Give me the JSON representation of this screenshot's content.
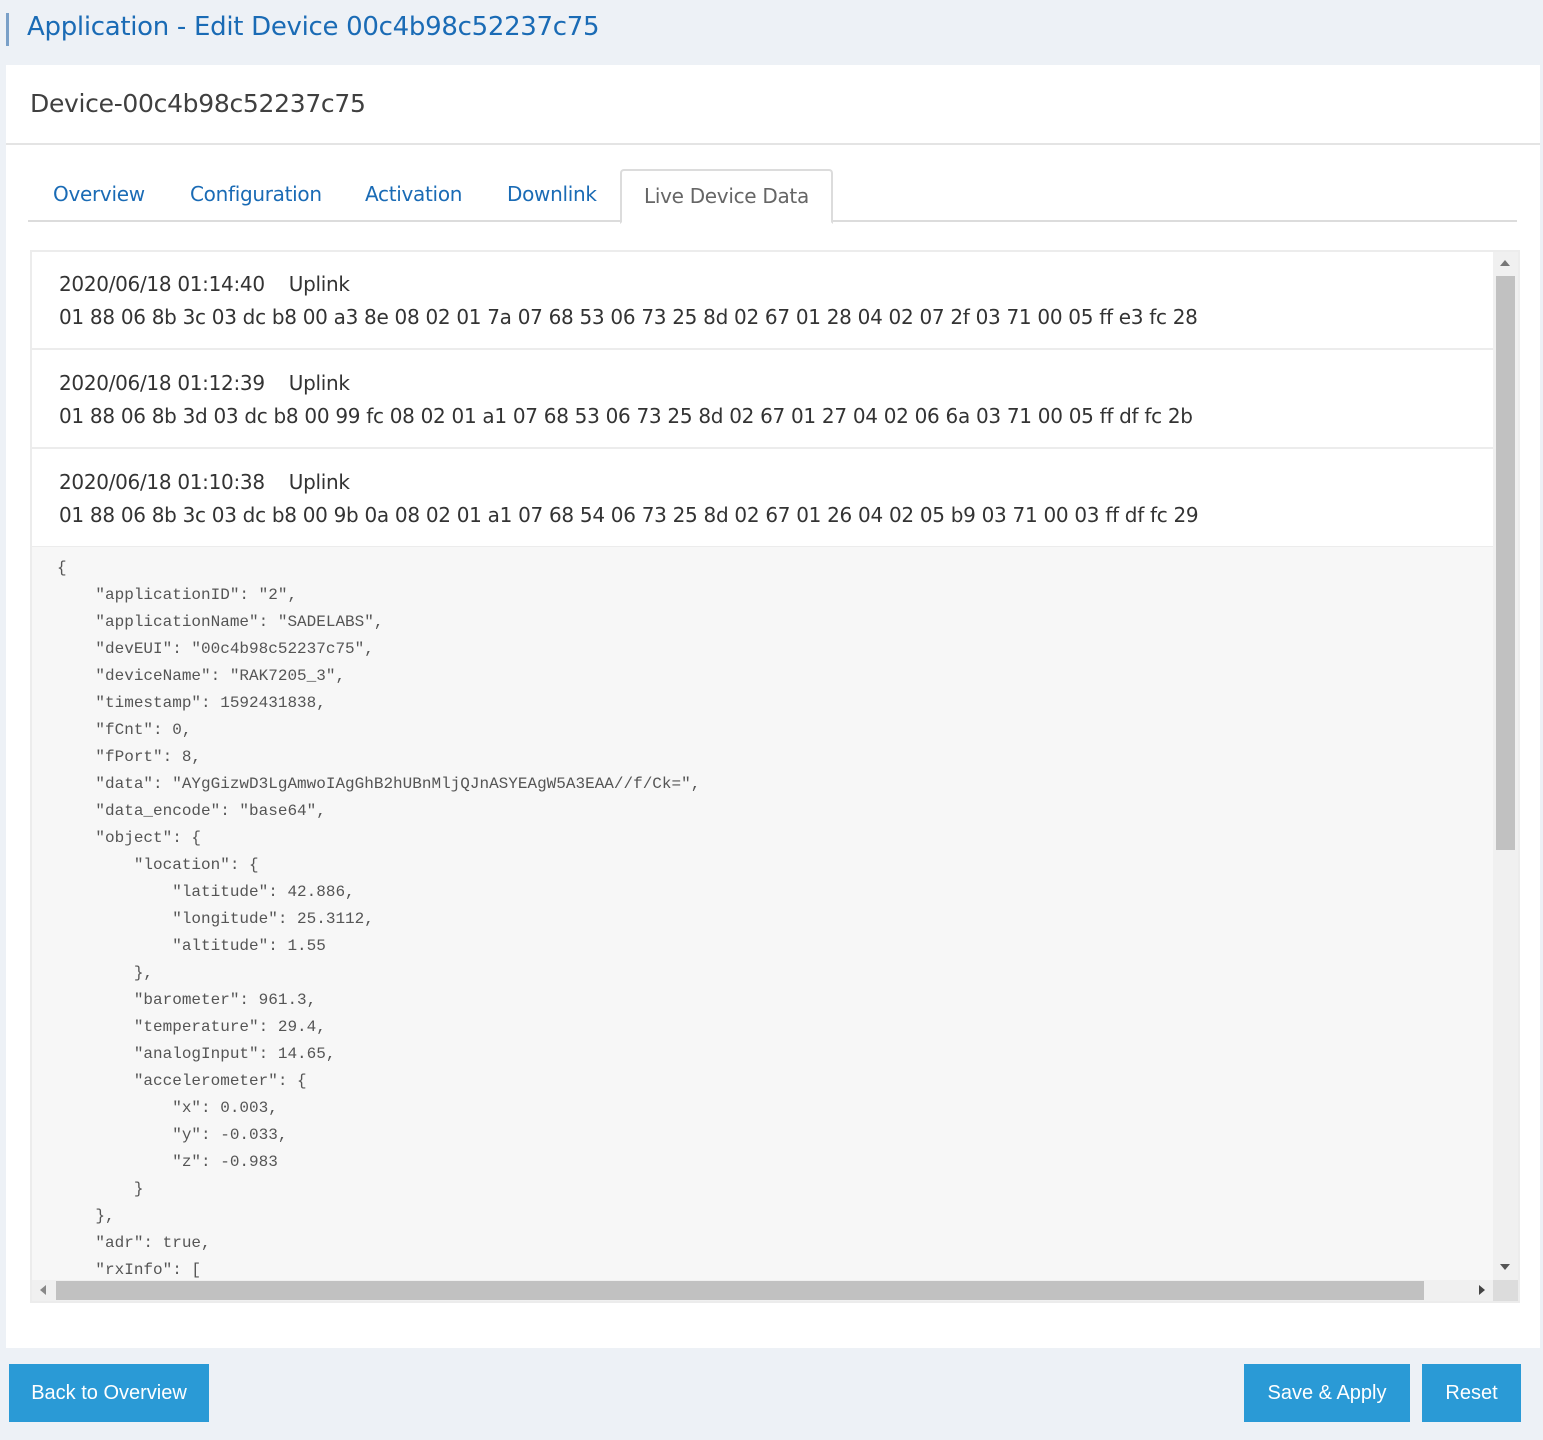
{
  "header": {
    "title": "Application - Edit Device 00c4b98c52237c75"
  },
  "card": {
    "title": "Device-00c4b98c52237c75"
  },
  "tabs": [
    {
      "label": "Overview",
      "active": false
    },
    {
      "label": "Configuration",
      "active": false
    },
    {
      "label": "Activation",
      "active": false
    },
    {
      "label": "Downlink",
      "active": false
    },
    {
      "label": "Live Device Data",
      "active": true
    }
  ],
  "uplinks": [
    {
      "timestamp": "2020/06/18 01:14:40",
      "type": "Uplink",
      "payload": "01 88 06 8b 3c 03 dc b8 00 a3 8e 08 02 01 7a 07 68 53 06 73 25 8d 02 67 01 28 04 02 07 2f 03 71 00 05 ff e3 fc 28"
    },
    {
      "timestamp": "2020/06/18 01:12:39",
      "type": "Uplink",
      "payload": "01 88 06 8b 3d 03 dc b8 00 99 fc 08 02 01 a1 07 68 53 06 73 25 8d 02 67 01 27 04 02 06 6a 03 71 00 05 ff df fc 2b"
    },
    {
      "timestamp": "2020/06/18 01:10:38",
      "type": "Uplink",
      "payload": "01 88 06 8b 3c 03 dc b8 00 9b 0a 08 02 01 a1 07 68 54 06 73 25 8d 02 67 01 26 04 02 05 b9 03 71 00 03 ff df fc 29"
    }
  ],
  "json_detail": {
    "text": "{\n    \"applicationID\": \"2\",\n    \"applicationName\": \"SADELABS\",\n    \"devEUI\": \"00c4b98c52237c75\",\n    \"deviceName\": \"RAK7205_3\",\n    \"timestamp\": 1592431838,\n    \"fCnt\": 0,\n    \"fPort\": 8,\n    \"data\": \"AYgGizwD3LgAmwoIAgGhB2hUBnMljQJnASYEAgW5A3EAA//f/Ck=\",\n    \"data_encode\": \"base64\",\n    \"object\": {\n        \"location\": {\n            \"latitude\": 42.886,\n            \"longitude\": 25.3112,\n            \"altitude\": 1.55\n        },\n        \"barometer\": 961.3,\n        \"temperature\": 29.4,\n        \"analogInput\": 14.65,\n        \"accelerometer\": {\n            \"x\": 0.003,\n            \"y\": -0.033,\n            \"z\": -0.983\n        }\n    },\n    \"adr\": true,\n    \"rxInfo\": ["
  },
  "buttons": {
    "back": "Back to Overview",
    "save": "Save & Apply",
    "reset": "Reset"
  },
  "colors": {
    "accent": "#2a9ad6",
    "link": "#1a6bb5",
    "background": "#edf1f6"
  }
}
